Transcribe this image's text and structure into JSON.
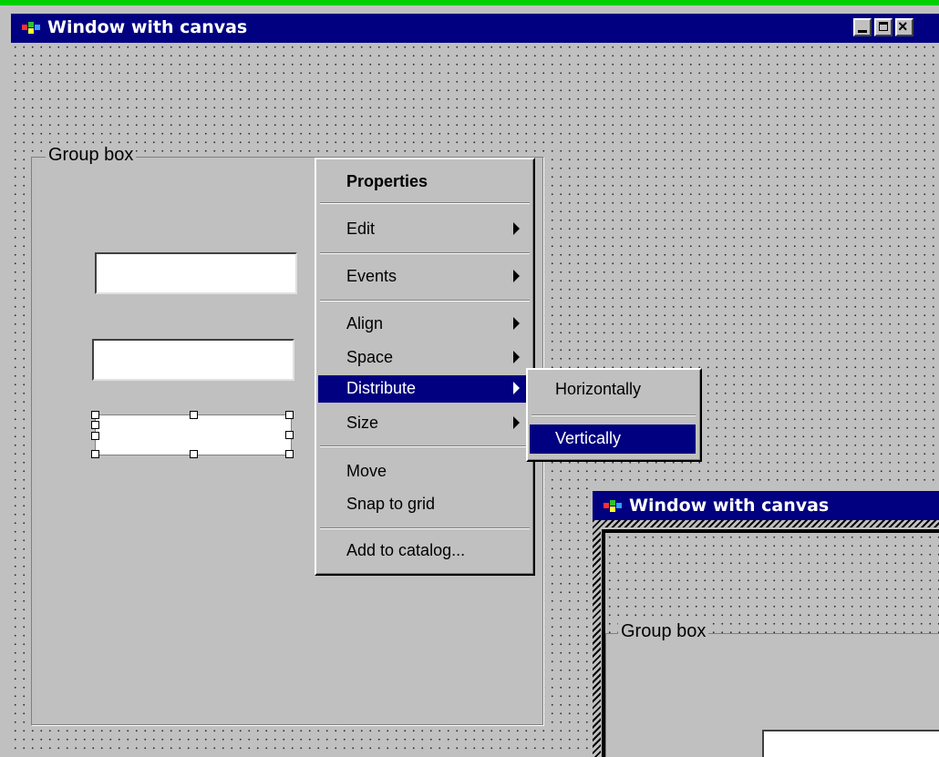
{
  "main_window": {
    "title": "Window with canvas",
    "controls": {
      "minimize_icon": "minimize-icon",
      "maximize_icon": "maximize-icon",
      "close_glyph": "×"
    }
  },
  "group_box": {
    "label": "Group box"
  },
  "context_menu": {
    "items": [
      {
        "label": "Properties",
        "bold": true,
        "submenu": false
      },
      {
        "label": "Edit",
        "submenu": true
      },
      {
        "label": "Events",
        "submenu": true
      },
      {
        "label": "Align",
        "submenu": true
      },
      {
        "label": "Space",
        "submenu": true
      },
      {
        "label": "Distribute",
        "submenu": true,
        "selected": true
      },
      {
        "label": "Size",
        "submenu": true
      },
      {
        "label": "Move",
        "submenu": false
      },
      {
        "label": "Snap to grid",
        "submenu": false
      },
      {
        "label": "Add to catalog...",
        "submenu": false
      }
    ]
  },
  "distribute_submenu": {
    "items": [
      {
        "label": "Horizontally"
      },
      {
        "label": "Vertically",
        "selected": true
      }
    ]
  },
  "second_window": {
    "title": "Window with canvas",
    "group_box_label": "Group box"
  },
  "colors": {
    "title_bar": "#000080",
    "selection": "#000080",
    "face": "#c0c0c0",
    "accent_strip": "#00d000"
  }
}
